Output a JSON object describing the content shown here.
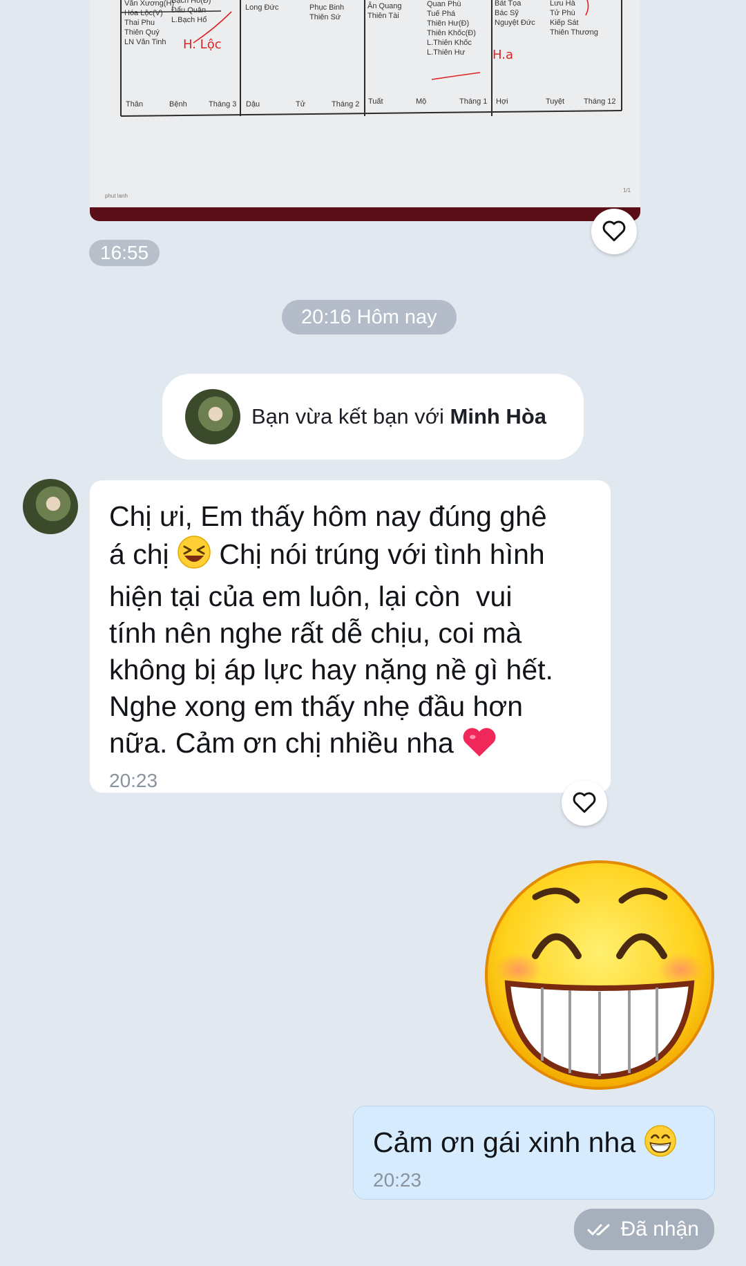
{
  "image_message": {
    "time": "16:55",
    "doc_cells": [
      {
        "lines": [
          "Văn Xương(H)",
          "Hóa Lộc(V)",
          "Thai Phu",
          "Thiên Quý",
          "LN Văn Tinh"
        ]
      },
      {
        "lines": [
          "Bạch Hổ(Đ)",
          "Đẩu Quân",
          "L.Bạch Hổ"
        ]
      },
      {
        "lines": [
          "Long Đức"
        ]
      },
      {
        "lines": [
          "Phục Binh",
          "Thiên Sứ"
        ]
      },
      {
        "lines": [
          "Ân Quang",
          "Thiên Tài"
        ]
      },
      {
        "lines": [
          "Quan Phù",
          "Tuế Phá",
          "Thiên Hư(Đ)",
          "Thiên Khốc(Đ)",
          "L.Thiên Khốc",
          "L.Thiên Hư"
        ]
      },
      {
        "lines": [
          "Bát Tọa",
          "Bác Sỹ",
          "Nguyệt Đức"
        ]
      },
      {
        "lines": [
          "Lưu Hà",
          "Tử Phù",
          "Kiếp Sát",
          "Thiên Thương"
        ]
      }
    ],
    "doc_footer": [
      "Thân",
      "Bệnh",
      "Tháng 3",
      "Dậu",
      "Tử",
      "Tháng 2",
      "Tuất",
      "Mộ",
      "Tháng 1",
      "Hợi",
      "Tuyệt",
      "Tháng 12"
    ],
    "handwritten": [
      "H. Lộc",
      "H.a"
    ]
  },
  "date_separator": "20:16 Hôm nay",
  "friend_notice": {
    "text": "Bạn vừa kết bạn với ",
    "name": "Minh Hòa"
  },
  "incoming_message": {
    "part1": "Chị ưi, Em thấy hôm nay đúng ghê\ná chị ",
    "part2": " Chị nói trúng với tình hình\nhiện tại của em luôn, lại còn  vui\ntính nên nghe rất dễ chịu, coi mà\nkhông bị áp lực hay nặng nề gì hết.\nNghe xong em thấy nhẹ đầu hơn\nnữa. Cảm ơn chị nhiều nha ",
    "time": "20:23"
  },
  "outgoing_message": {
    "text": "Cảm ơn gái xinh nha ",
    "time": "20:23"
  },
  "status": "Đã nhận",
  "icons": [
    "heart-outline-icon",
    "double-check-icon",
    "grinning-squint-emoji",
    "heart-emoji",
    "big-grin-sticker"
  ],
  "colors": {
    "background": "#e2e8f0",
    "incoming_bubble": "#ffffff",
    "outgoing_bubble": "#d6ecfe",
    "pill": "#b3bcc8"
  }
}
